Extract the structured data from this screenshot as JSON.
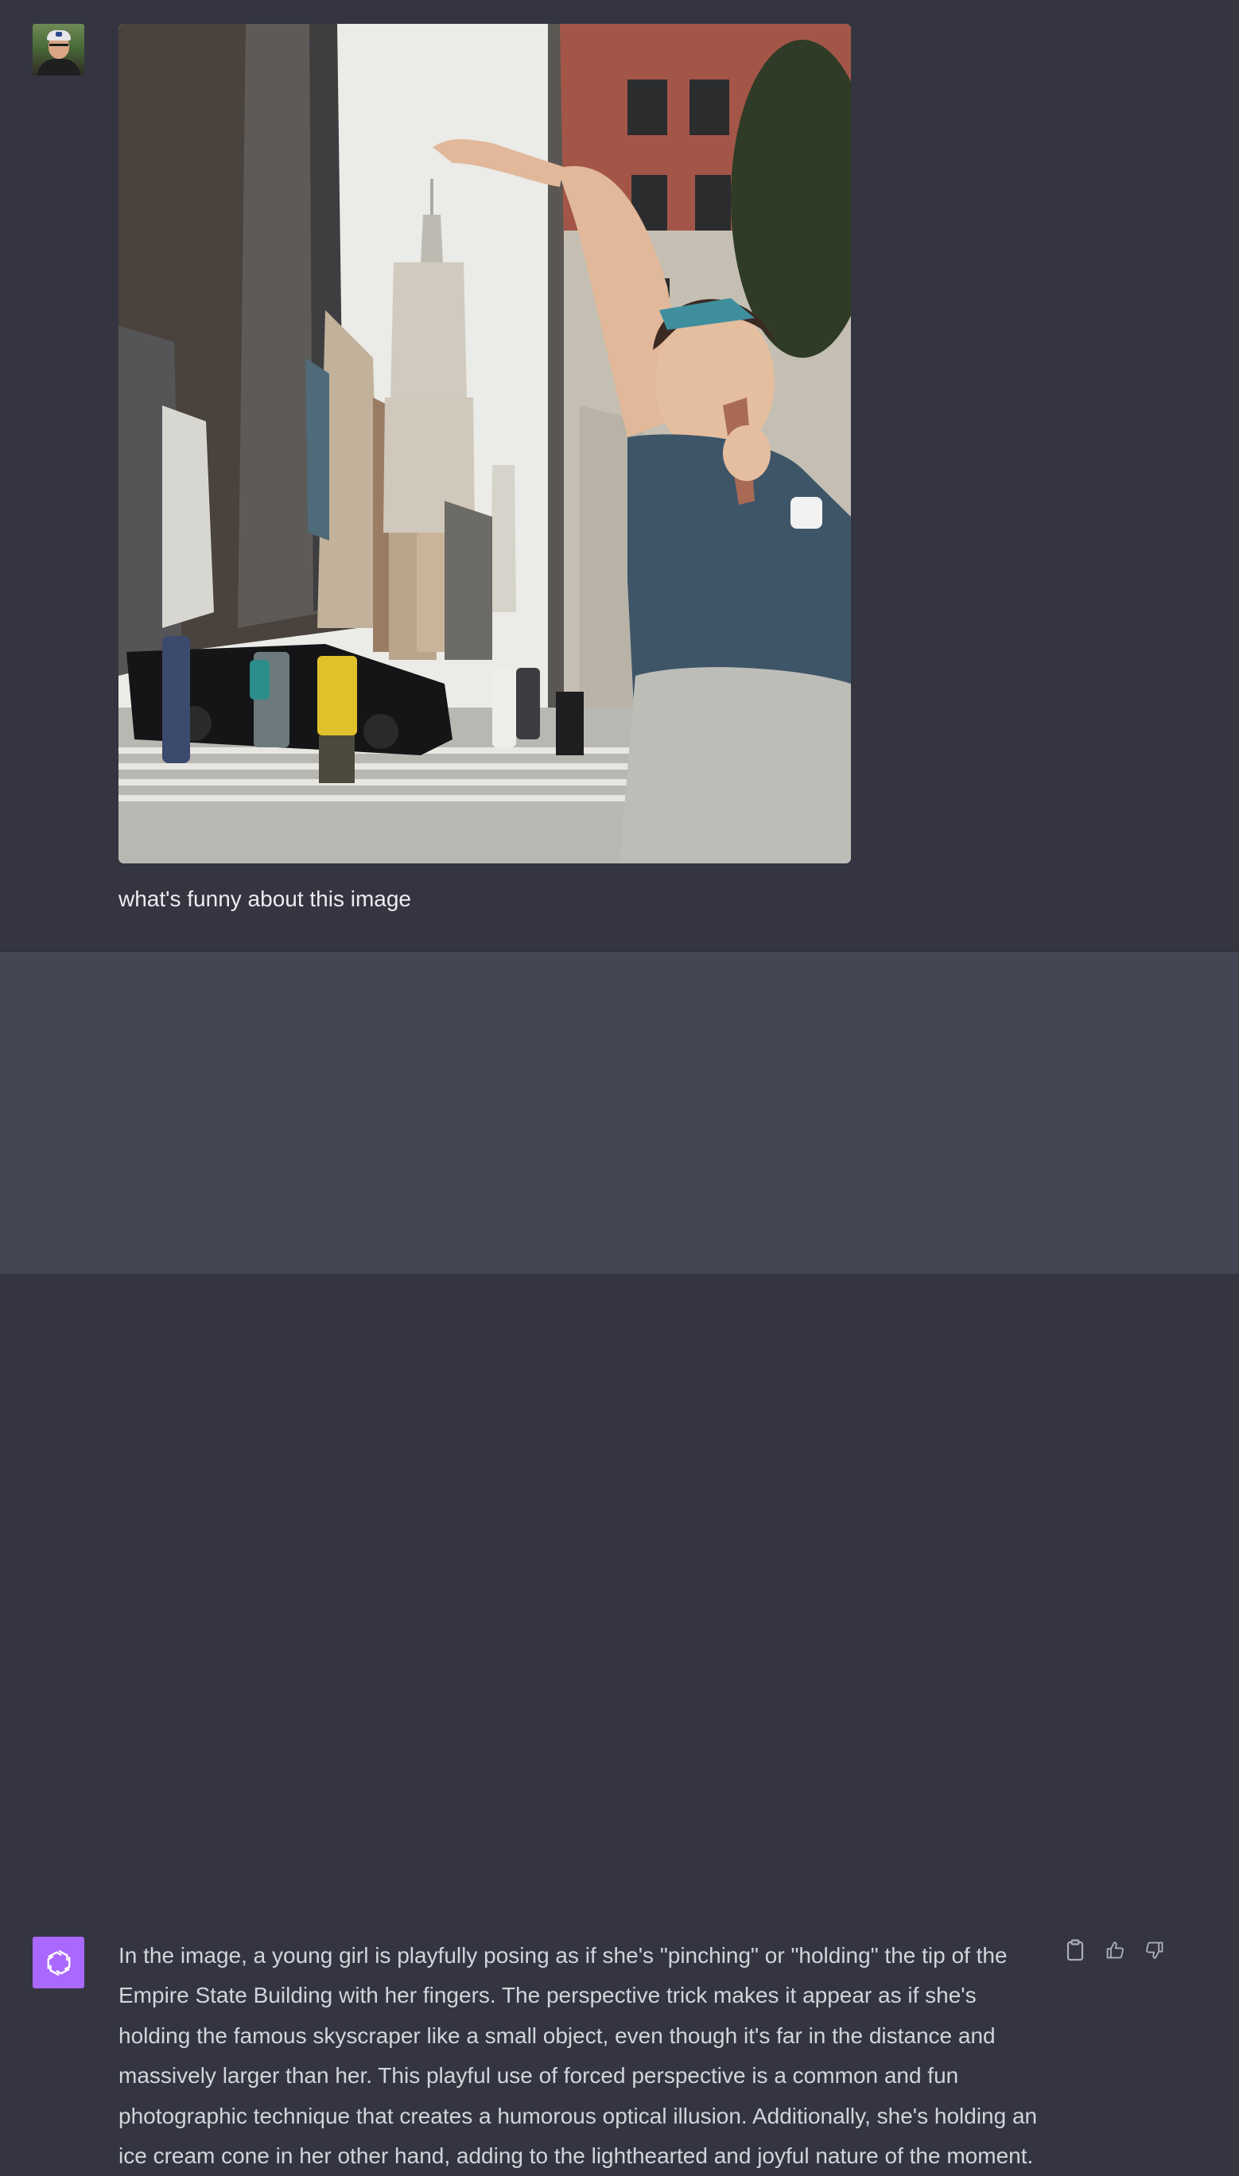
{
  "user_message": {
    "avatar": "user-avatar-photo",
    "image": "uploaded-photo",
    "text": "what's funny about this image"
  },
  "assistant_message": {
    "avatar": "openai-logo-icon",
    "avatar_color": "#ab68ff",
    "text": "In the image, a young girl is playfully posing as if she's \"pinching\" or \"holding\" the tip of the Empire State Building with her fingers. The perspective trick makes it appear as if she's holding the famous skyscraper like a small object, even though it's far in the distance and massively larger than her. This playful use of forced perspective is a common and fun photographic technique that creates a humorous optical illusion. Additionally, she's holding an ice cream cone in her other hand, adding to the lighthearted and joyful nature of the moment.",
    "actions": [
      {
        "name": "copy",
        "icon": "clipboard-icon"
      },
      {
        "name": "thumbs-up",
        "icon": "thumbs-up-icon"
      },
      {
        "name": "thumbs-down",
        "icon": "thumbs-down-icon"
      }
    ]
  },
  "colors": {
    "user_bg": "#343541",
    "assistant_bg": "#444654",
    "user_text": "#ececf1",
    "assistant_text": "#d1d5db",
    "icon": "#acacbe"
  }
}
